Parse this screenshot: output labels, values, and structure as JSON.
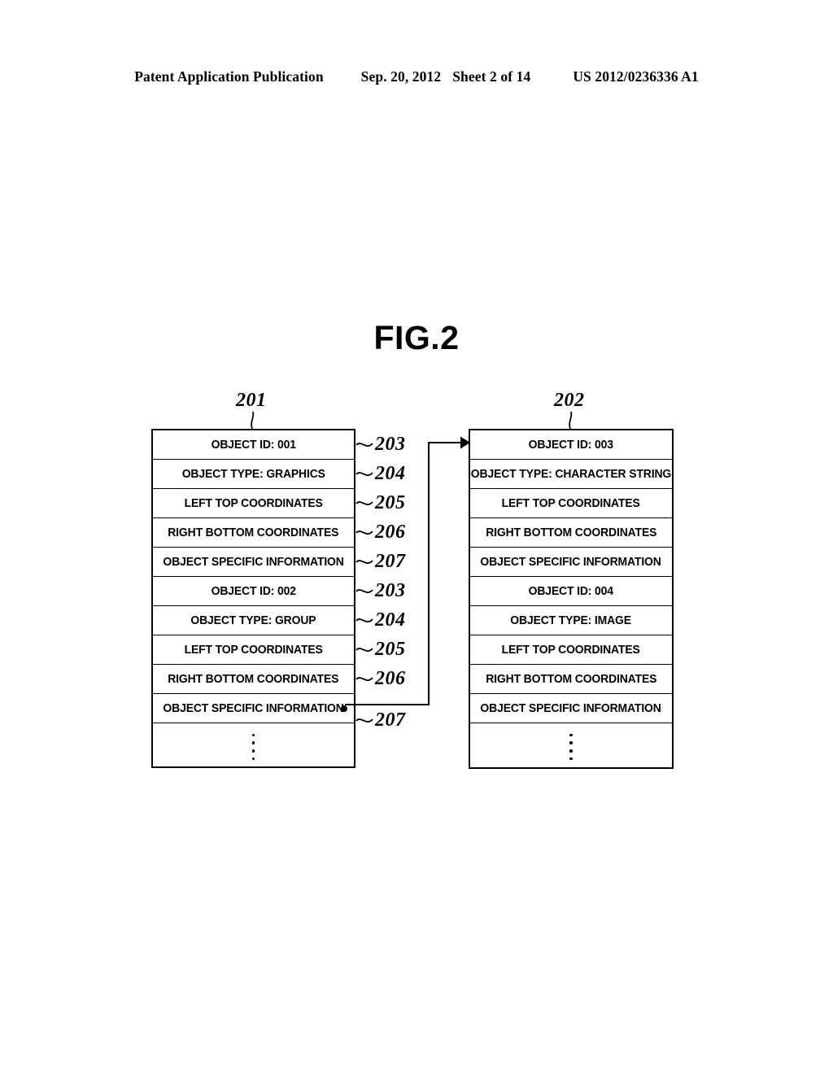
{
  "header": {
    "publication": "Patent Application Publication",
    "date": "Sep. 20, 2012",
    "sheet": "Sheet 2 of 14",
    "patent_number": "US 2012/0236336 A1"
  },
  "figure": {
    "title": "FIG.2",
    "left_table_ref": "201",
    "right_table_ref": "202"
  },
  "tables": {
    "left": {
      "ref": "201",
      "rows": [
        {
          "label": "OBJECT ID: 001",
          "ref": "203"
        },
        {
          "label": "OBJECT TYPE: GRAPHICS",
          "ref": "204"
        },
        {
          "label": "LEFT TOP COORDINATES",
          "ref": "205"
        },
        {
          "label": "RIGHT BOTTOM COORDINATES",
          "ref": "206"
        },
        {
          "label": "OBJECT SPECIFIC INFORMATION",
          "ref": "207"
        },
        {
          "label": "OBJECT ID: 002",
          "ref": "203"
        },
        {
          "label": "OBJECT TYPE: GROUP",
          "ref": "204"
        },
        {
          "label": "LEFT TOP COORDINATES",
          "ref": "205"
        },
        {
          "label": "RIGHT BOTTOM COORDINATES",
          "ref": "206"
        },
        {
          "label": "OBJECT SPECIFIC INFORMATION",
          "ref": "207"
        }
      ],
      "ellipsis_dots": 4
    },
    "right": {
      "ref": "202",
      "rows": [
        {
          "label": "OBJECT ID: 003"
        },
        {
          "label": "OBJECT TYPE: CHARACTER STRING"
        },
        {
          "label": "LEFT TOP COORDINATES"
        },
        {
          "label": "RIGHT BOTTOM COORDINATES"
        },
        {
          "label": "OBJECT SPECIFIC INFORMATION"
        },
        {
          "label": "OBJECT ID: 004"
        },
        {
          "label": "OBJECT TYPE: IMAGE"
        },
        {
          "label": "LEFT TOP COORDINATES"
        },
        {
          "label": "RIGHT BOTTOM COORDINATES"
        },
        {
          "label": "OBJECT SPECIFIC INFORMATION"
        }
      ],
      "ellipsis_dots": 4
    }
  },
  "connector": {
    "description": "pointer from OBJECT SPECIFIC INFORMATION of object 002 to OBJECT ID: 003 row",
    "source_row_index": 9,
    "target_row_index": 0
  },
  "colors": {
    "ink": "#000000",
    "paper": "#ffffff"
  }
}
